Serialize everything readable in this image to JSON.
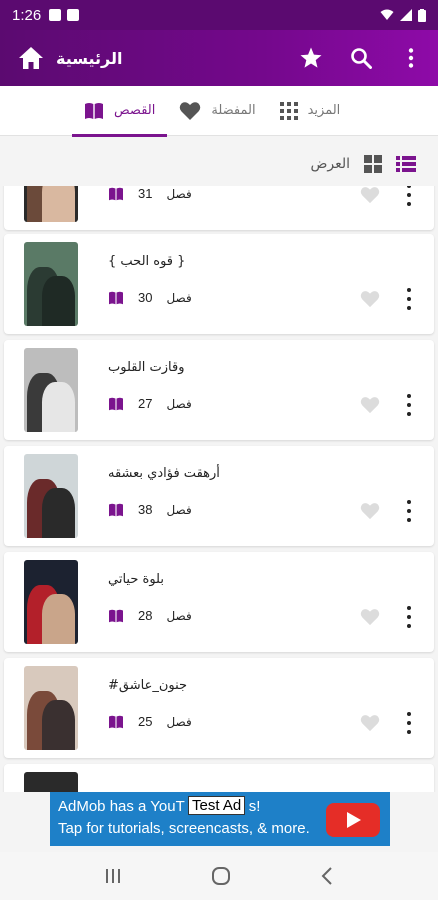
{
  "status": {
    "time": "1:26"
  },
  "appbar": {
    "title": "الرئيسية",
    "icons": {
      "home": "home-icon",
      "star": "star-icon",
      "search": "search-icon",
      "more": "more-vert-icon"
    },
    "color": "#6a0a80"
  },
  "tabs": [
    {
      "label": "المزيد",
      "icon": "grid-icon",
      "active": false
    },
    {
      "label": "المفضلة",
      "icon": "heart-icon",
      "active": false
    },
    {
      "label": "القصص",
      "icon": "book-icon",
      "active": true
    }
  ],
  "view": {
    "label": "العرض",
    "options": [
      "grid-view-icon",
      "list-view-icon"
    ],
    "selected": "list-view-icon"
  },
  "stories": [
    {
      "title": "",
      "chapters": "31",
      "chapter_label": "فصل",
      "partial": true
    },
    {
      "title": "{ قوه الحب }",
      "chapters": "30",
      "chapter_label": "فصل"
    },
    {
      "title": "وقازت القلوب",
      "chapters": "27",
      "chapter_label": "فصل"
    },
    {
      "title": "أرهقت فؤادي بعشقه",
      "chapters": "38",
      "chapter_label": "فصل"
    },
    {
      "title": "بلوة حياتي",
      "chapters": "28",
      "chapter_label": "فصل"
    },
    {
      "title": "#جنون_عاشق",
      "chapters": "25",
      "chapter_label": "فصل"
    }
  ],
  "ad": {
    "line1": "AdMob has a YouT",
    "line1_tail": "s!",
    "badge": "Test Ad",
    "line2": "Tap for tutorials, screencasts, & more."
  },
  "accent": "#7b148e"
}
